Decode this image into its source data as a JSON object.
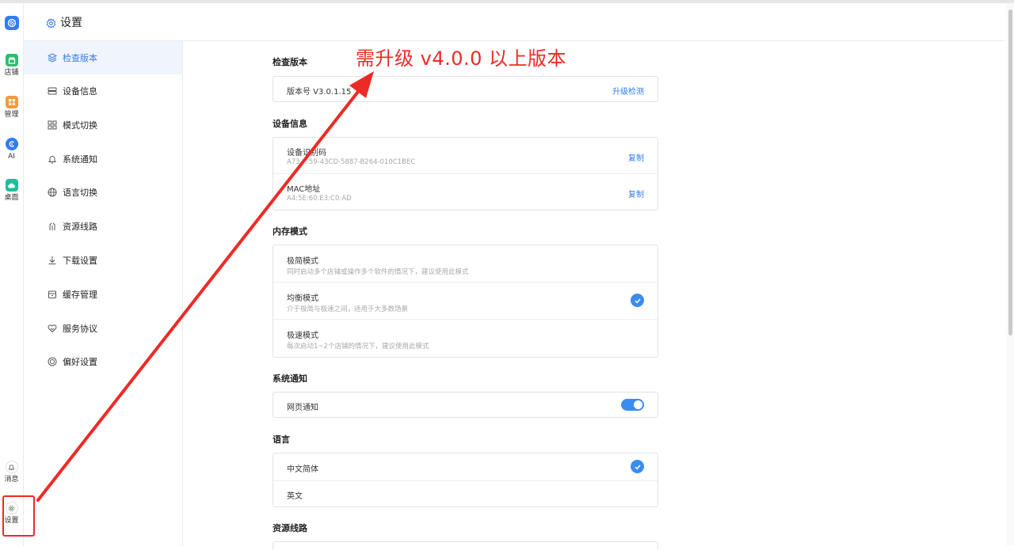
{
  "rail": {
    "items": [
      {
        "label": "店铺",
        "icon": "store-icon",
        "color": "#2ebd6e"
      },
      {
        "label": "管理",
        "icon": "grid-icon",
        "color": "#f59a3c"
      },
      {
        "label": "AI",
        "icon": "ai-icon",
        "color": "#2f7cf6"
      },
      {
        "label": "桌面",
        "icon": "cloud-icon",
        "color": "#1fbf9a"
      }
    ],
    "bottom": [
      {
        "label": "消息",
        "icon": "bell-icon"
      },
      {
        "label": "设置",
        "icon": "gear-icon"
      }
    ]
  },
  "header": {
    "title": "设置"
  },
  "nav": {
    "active_index": 0,
    "items": [
      {
        "label": "检查版本",
        "icon": "layers-icon"
      },
      {
        "label": "设备信息",
        "icon": "server-icon"
      },
      {
        "label": "模式切换",
        "icon": "grid-icon"
      },
      {
        "label": "系统通知",
        "icon": "bell-icon"
      },
      {
        "label": "语言切换",
        "icon": "globe-icon"
      },
      {
        "label": "资源线路",
        "icon": "route-icon"
      },
      {
        "label": "下载设置",
        "icon": "download-icon"
      },
      {
        "label": "缓存管理",
        "icon": "storage-icon"
      },
      {
        "label": "服务协议",
        "icon": "handshake-icon"
      },
      {
        "label": "偏好设置",
        "icon": "preference-icon"
      }
    ]
  },
  "sections": {
    "version": {
      "title": "检查版本",
      "label": "版本号 V3.0.1.15",
      "action": "升级检测"
    },
    "device": {
      "title": "设备信息",
      "rows": [
        {
          "label": "设备识别码",
          "value": "A73… 59-43CD-5887-B264-010C1BEC",
          "action": "复制"
        },
        {
          "label": "MAC地址",
          "value": "A4:5E:60:E3:C0:AD",
          "action": "复制"
        }
      ]
    },
    "memory": {
      "title": "内存模式",
      "rows": [
        {
          "label": "极简模式",
          "desc": "同时启动多个店铺或操作多个软件的情况下，建议使用此模式",
          "selected": false
        },
        {
          "label": "均衡模式",
          "desc": "介于极简与极速之间，适用于大多数场景",
          "selected": true
        },
        {
          "label": "极速模式",
          "desc": "每次启动1~2个店铺的情况下，建议使用此模式",
          "selected": false
        }
      ]
    },
    "notify": {
      "title": "系统通知",
      "label": "网页通知",
      "enabled": true
    },
    "language": {
      "title": "语言",
      "rows": [
        {
          "label": "中文简体",
          "selected": true
        },
        {
          "label": "英文",
          "selected": false
        }
      ]
    },
    "route": {
      "title": "资源线路"
    }
  },
  "annotation": {
    "text": "需升级 v4.0.0 以上版本",
    "color": "#ee2a25"
  }
}
